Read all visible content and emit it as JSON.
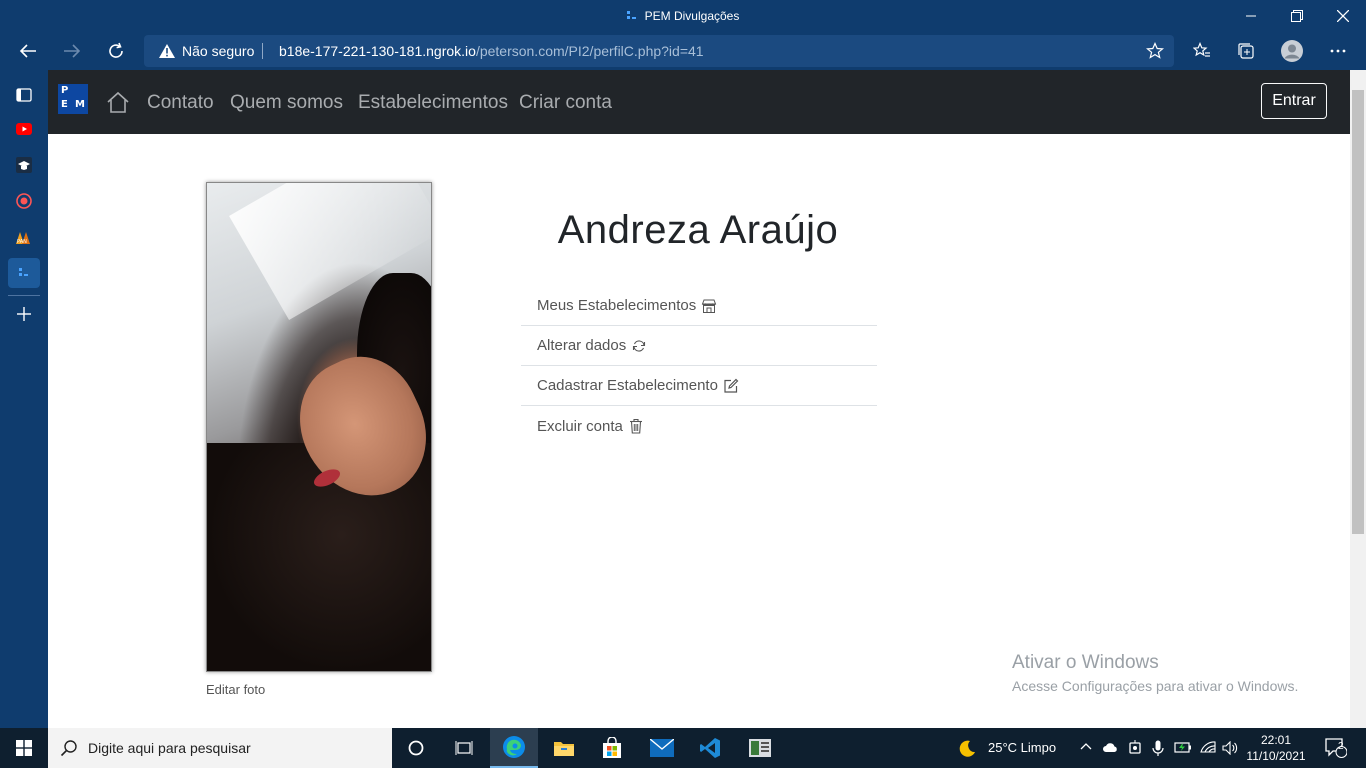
{
  "browser": {
    "window_title": "PEM Divulgações",
    "security_label": "Não seguro",
    "url_host": "b18e-177-221-130-181.ngrok.io",
    "url_path": "/peterson.com/PI2/perfilC.php?id=41"
  },
  "site_nav": {
    "logo_letters": [
      "P",
      "E",
      "M"
    ],
    "links": [
      "Contato",
      "Quem somos",
      "Estabelecimentos",
      "Criar conta"
    ],
    "login_button": "Entrar"
  },
  "profile": {
    "name": "Andreza Araújo",
    "edit_photo": "Editar foto",
    "menu": [
      {
        "label": "Meus Estabelecimentos",
        "icon": "shop-icon"
      },
      {
        "label": "Alterar dados",
        "icon": "refresh-icon"
      },
      {
        "label": "Cadastrar Estabelecimento",
        "icon": "edit-icon"
      },
      {
        "label": "Excluir conta",
        "icon": "trash-icon"
      }
    ]
  },
  "watermark": {
    "title": "Ativar o Windows",
    "subtitle": "Acesse Configurações para ativar o Windows."
  },
  "taskbar": {
    "search_placeholder": "Digite aqui para pesquisar",
    "weather": "25°C  Limpo",
    "time": "22:01",
    "date": "11/10/2021",
    "notifications": "2"
  }
}
